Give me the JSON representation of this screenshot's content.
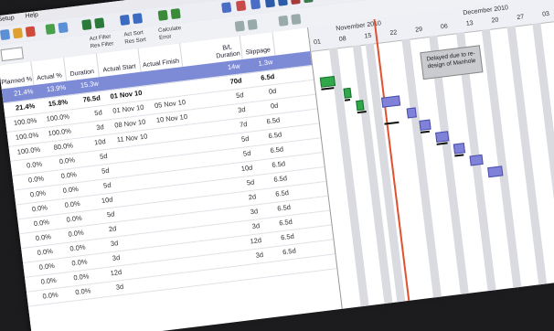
{
  "menu": [
    "Setup",
    "Help"
  ],
  "toolbar2": {
    "filters": [
      "Act Filter",
      "Res Filter",
      "Act Sort",
      "Res Sort",
      "Calculate",
      "Error"
    ]
  },
  "columns": [
    "Planned %",
    "Actual %",
    "Duration",
    "Actual Start",
    "Actual Finish",
    "B/L Duration",
    "Slippage"
  ],
  "rows": [
    {
      "planned": "21.4%",
      "actual": "13.9%",
      "duration": "15.3w",
      "start": "",
      "finish": "",
      "bl": "14w",
      "slip": "1.3w",
      "selected": true
    },
    {
      "planned": "21.4%",
      "actual": "15.8%",
      "duration": "76.5d",
      "start": "01 Nov 10",
      "finish": "",
      "bl": "70d",
      "slip": "6.5d",
      "bold": true
    },
    {
      "planned": "100.0%",
      "actual": "100.0%",
      "duration": "5d",
      "start": "01 Nov 10",
      "finish": "05 Nov 10",
      "bl": "5d",
      "slip": "0d"
    },
    {
      "planned": "100.0%",
      "actual": "100.0%",
      "duration": "3d",
      "start": "08 Nov 10",
      "finish": "10 Nov 10",
      "bl": "3d",
      "slip": "0d"
    },
    {
      "planned": "100.0%",
      "actual": "80.0%",
      "duration": "10d",
      "start": "11 Nov 10",
      "finish": "",
      "bl": "7d",
      "slip": "6.5d"
    },
    {
      "planned": "0.0%",
      "actual": "0.0%",
      "duration": "5d",
      "start": "",
      "finish": "",
      "bl": "5d",
      "slip": "6.5d"
    },
    {
      "planned": "0.0%",
      "actual": "0.0%",
      "duration": "5d",
      "start": "",
      "finish": "",
      "bl": "5d",
      "slip": "6.5d"
    },
    {
      "planned": "0.0%",
      "actual": "0.0%",
      "duration": "5d",
      "start": "",
      "finish": "",
      "bl": "10d",
      "slip": "6.5d"
    },
    {
      "planned": "0.0%",
      "actual": "0.0%",
      "duration": "10d",
      "start": "",
      "finish": "",
      "bl": "5d",
      "slip": "6.5d"
    },
    {
      "planned": "0.0%",
      "actual": "0.0%",
      "duration": "5d",
      "start": "",
      "finish": "",
      "bl": "2d",
      "slip": "6.5d"
    },
    {
      "planned": "0.0%",
      "actual": "0.0%",
      "duration": "2d",
      "start": "",
      "finish": "",
      "bl": "3d",
      "slip": "6.5d"
    },
    {
      "planned": "0.0%",
      "actual": "0.0%",
      "duration": "3d",
      "start": "",
      "finish": "",
      "bl": "3d",
      "slip": "6.5d"
    },
    {
      "planned": "0.0%",
      "actual": "0.0%",
      "duration": "3d",
      "start": "",
      "finish": "",
      "bl": "12d",
      "slip": "6.5d"
    },
    {
      "planned": "0.0%",
      "actual": "0.0%",
      "duration": "12d",
      "start": "",
      "finish": "",
      "bl": "3d",
      "slip": "6.5d"
    },
    {
      "planned": "0.0%",
      "actual": "0.0%",
      "duration": "3d",
      "start": "",
      "finish": "",
      "bl": "",
      "slip": ""
    }
  ],
  "gantt": {
    "months": [
      "November 2010",
      "December 2010"
    ],
    "days": [
      "01",
      "08",
      "15",
      "22",
      "29",
      "06",
      "13",
      "20",
      "27",
      "03"
    ],
    "callout": "Delayed due to re-design of Manhole"
  }
}
